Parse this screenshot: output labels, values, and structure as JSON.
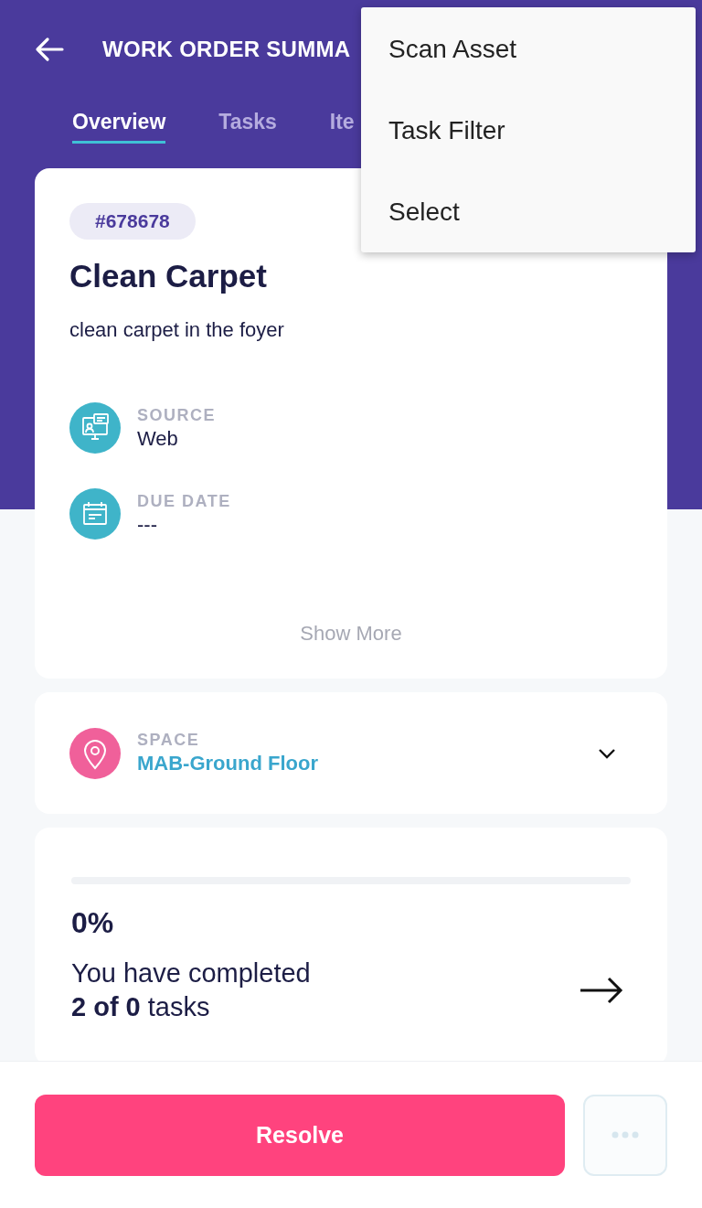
{
  "header": {
    "title": "WORK ORDER SUMMA"
  },
  "tabs": [
    {
      "label": "Overview",
      "selected": true
    },
    {
      "label": "Tasks",
      "selected": false
    },
    {
      "label": "Ite",
      "selected": false
    }
  ],
  "menu": [
    "Scan Asset",
    "Task Filter",
    "Select"
  ],
  "work_order": {
    "number": "#678678",
    "title": "Clean Carpet",
    "description": "clean carpet in the foyer",
    "fields": [
      {
        "kind": "source",
        "label": "SOURCE",
        "value": "Web"
      },
      {
        "kind": "due",
        "label": "DUE DATE",
        "value": "---"
      }
    ],
    "show_more": "Show More"
  },
  "space": {
    "label": "SPACE",
    "value": "MAB-Ground Floor"
  },
  "progress": {
    "level": 0,
    "percent": "0%",
    "line1": "You have completed",
    "line2": "**2 of 0** tasks"
  },
  "actions": {
    "primary": "Resolve"
  }
}
